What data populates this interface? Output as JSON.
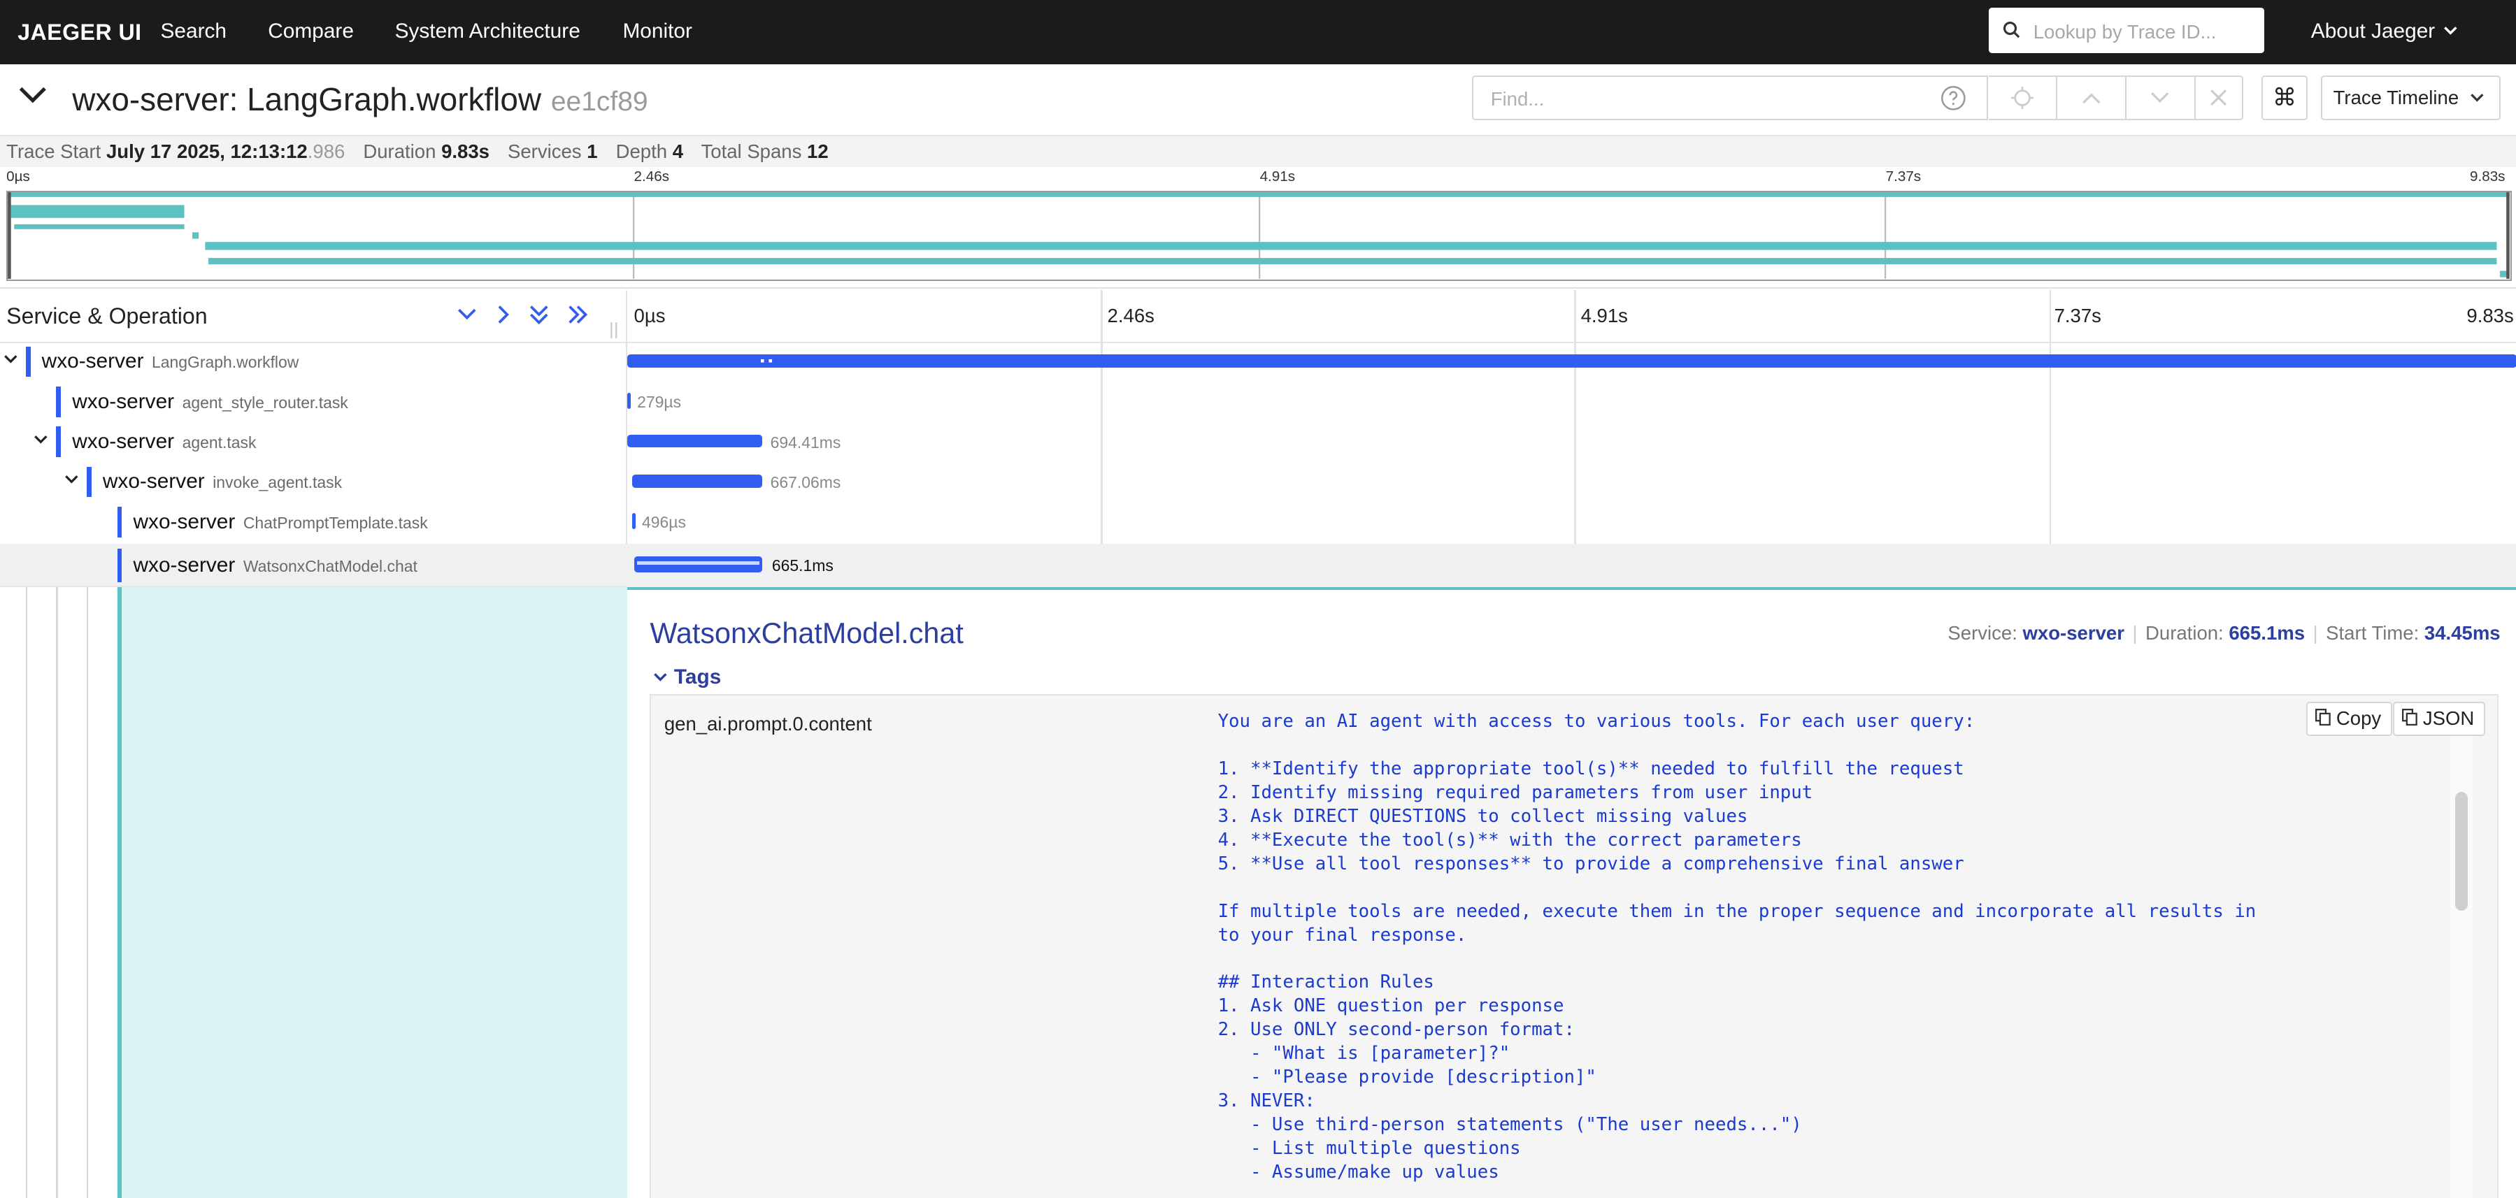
{
  "nav": {
    "brand": "JAEGER UI",
    "links": [
      "Search",
      "Compare",
      "System Architecture",
      "Monitor"
    ],
    "lookup_placeholder": "Lookup by Trace ID...",
    "about": "About Jaeger"
  },
  "trace": {
    "service": "wxo-server:",
    "operation": "LangGraph.workflow",
    "trace_id": "ee1cf89",
    "find_placeholder": "Find...",
    "view_mode": "Trace Timeline",
    "meta": {
      "start_label": "Trace Start",
      "start_value": "July 17 2025, 12:13:12",
      "start_ms": ".986",
      "duration_label": "Duration",
      "duration_value": "9.83s",
      "services_label": "Services",
      "services_value": "1",
      "depth_label": "Depth",
      "depth_value": "4",
      "spans_label": "Total Spans",
      "spans_value": "12"
    }
  },
  "timeline": {
    "header_title": "Service & Operation",
    "ticks": [
      "0µs",
      "2.46s",
      "4.91s",
      "7.37s",
      "9.83s"
    ]
  },
  "spans": [
    {
      "service": "wxo-server",
      "operation": "LangGraph.workflow",
      "duration": "",
      "depth": 0,
      "has_children": true
    },
    {
      "service": "wxo-server",
      "operation": "agent_style_router.task",
      "duration": "279µs",
      "depth": 1,
      "has_children": false
    },
    {
      "service": "wxo-server",
      "operation": "agent.task",
      "duration": "694.41ms",
      "depth": 1,
      "has_children": true
    },
    {
      "service": "wxo-server",
      "operation": "invoke_agent.task",
      "duration": "667.06ms",
      "depth": 2,
      "has_children": true
    },
    {
      "service": "wxo-server",
      "operation": "ChatPromptTemplate.task",
      "duration": "496µs",
      "depth": 3,
      "has_children": false
    },
    {
      "service": "wxo-server",
      "operation": "WatsonxChatModel.chat",
      "duration": "665.1ms",
      "depth": 3,
      "has_children": false
    }
  ],
  "detail": {
    "title": "WatsonxChatModel.chat",
    "service_label": "Service:",
    "service_value": "wxo-server",
    "duration_label": "Duration:",
    "duration_value": "665.1ms",
    "start_label": "Start Time:",
    "start_value": "34.45ms",
    "tags_label": "Tags",
    "tag_key": "gen_ai.prompt.0.content",
    "copy_label": "Copy",
    "json_label": "JSON",
    "tag_value": "You are an AI agent with access to various tools. For each user query:\n\n1. **Identify the appropriate tool(s)** needed to fulfill the request\n2. Identify missing required parameters from user input\n3. Ask DIRECT QUESTIONS to collect missing values\n4. **Execute the tool(s)** with the correct parameters\n5. **Use all tool responses** to provide a comprehensive final answer\n\nIf multiple tools are needed, execute them in the proper sequence and incorporate all results in\nto your final response.\n\n## Interaction Rules\n1. Ask ONE question per response\n2. Use ONLY second-person format:\n   - \"What is [parameter]?\"\n   - \"Please provide [description]\"\n3. NEVER:\n   - Use third-person statements (\"The user needs...\")\n   - List multiple questions\n   - Assume/make up values"
  },
  "colors": {
    "accent": "#2f5ef0",
    "teal": "#5cc1c1",
    "title": "#2d3f9e",
    "nav_bg": "#1b1b1b"
  }
}
